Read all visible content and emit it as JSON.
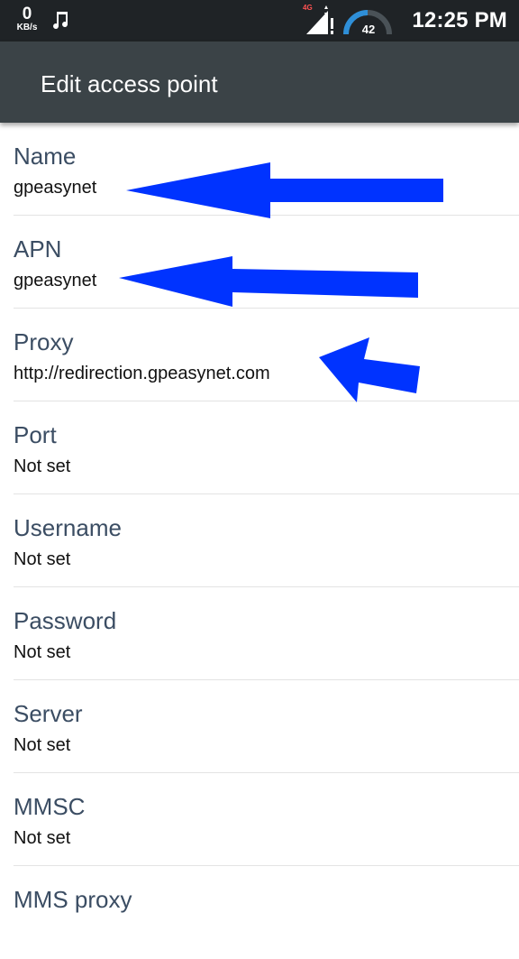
{
  "status_bar": {
    "speed_value": "0",
    "speed_unit": "KB/s",
    "network_type": "4G",
    "battery_level": "42",
    "time": "12:25 PM",
    "icons": [
      "music-note-icon",
      "signal-icon",
      "battery-gauge-icon"
    ]
  },
  "app_bar": {
    "title": "Edit access point"
  },
  "preferences": [
    {
      "title": "Name",
      "summary": "gpeasynet"
    },
    {
      "title": "APN",
      "summary": "gpeasynet"
    },
    {
      "title": "Proxy",
      "summary": "http://redirection.gpeasynet.com"
    },
    {
      "title": "Port",
      "summary": "Not set"
    },
    {
      "title": "Username",
      "summary": "Not set"
    },
    {
      "title": "Password",
      "summary": "Not set"
    },
    {
      "title": "Server",
      "summary": "Not set"
    },
    {
      "title": "MMSC",
      "summary": "Not set"
    },
    {
      "title": "MMS proxy",
      "summary": ""
    }
  ],
  "annotation_color": "#0033ff"
}
